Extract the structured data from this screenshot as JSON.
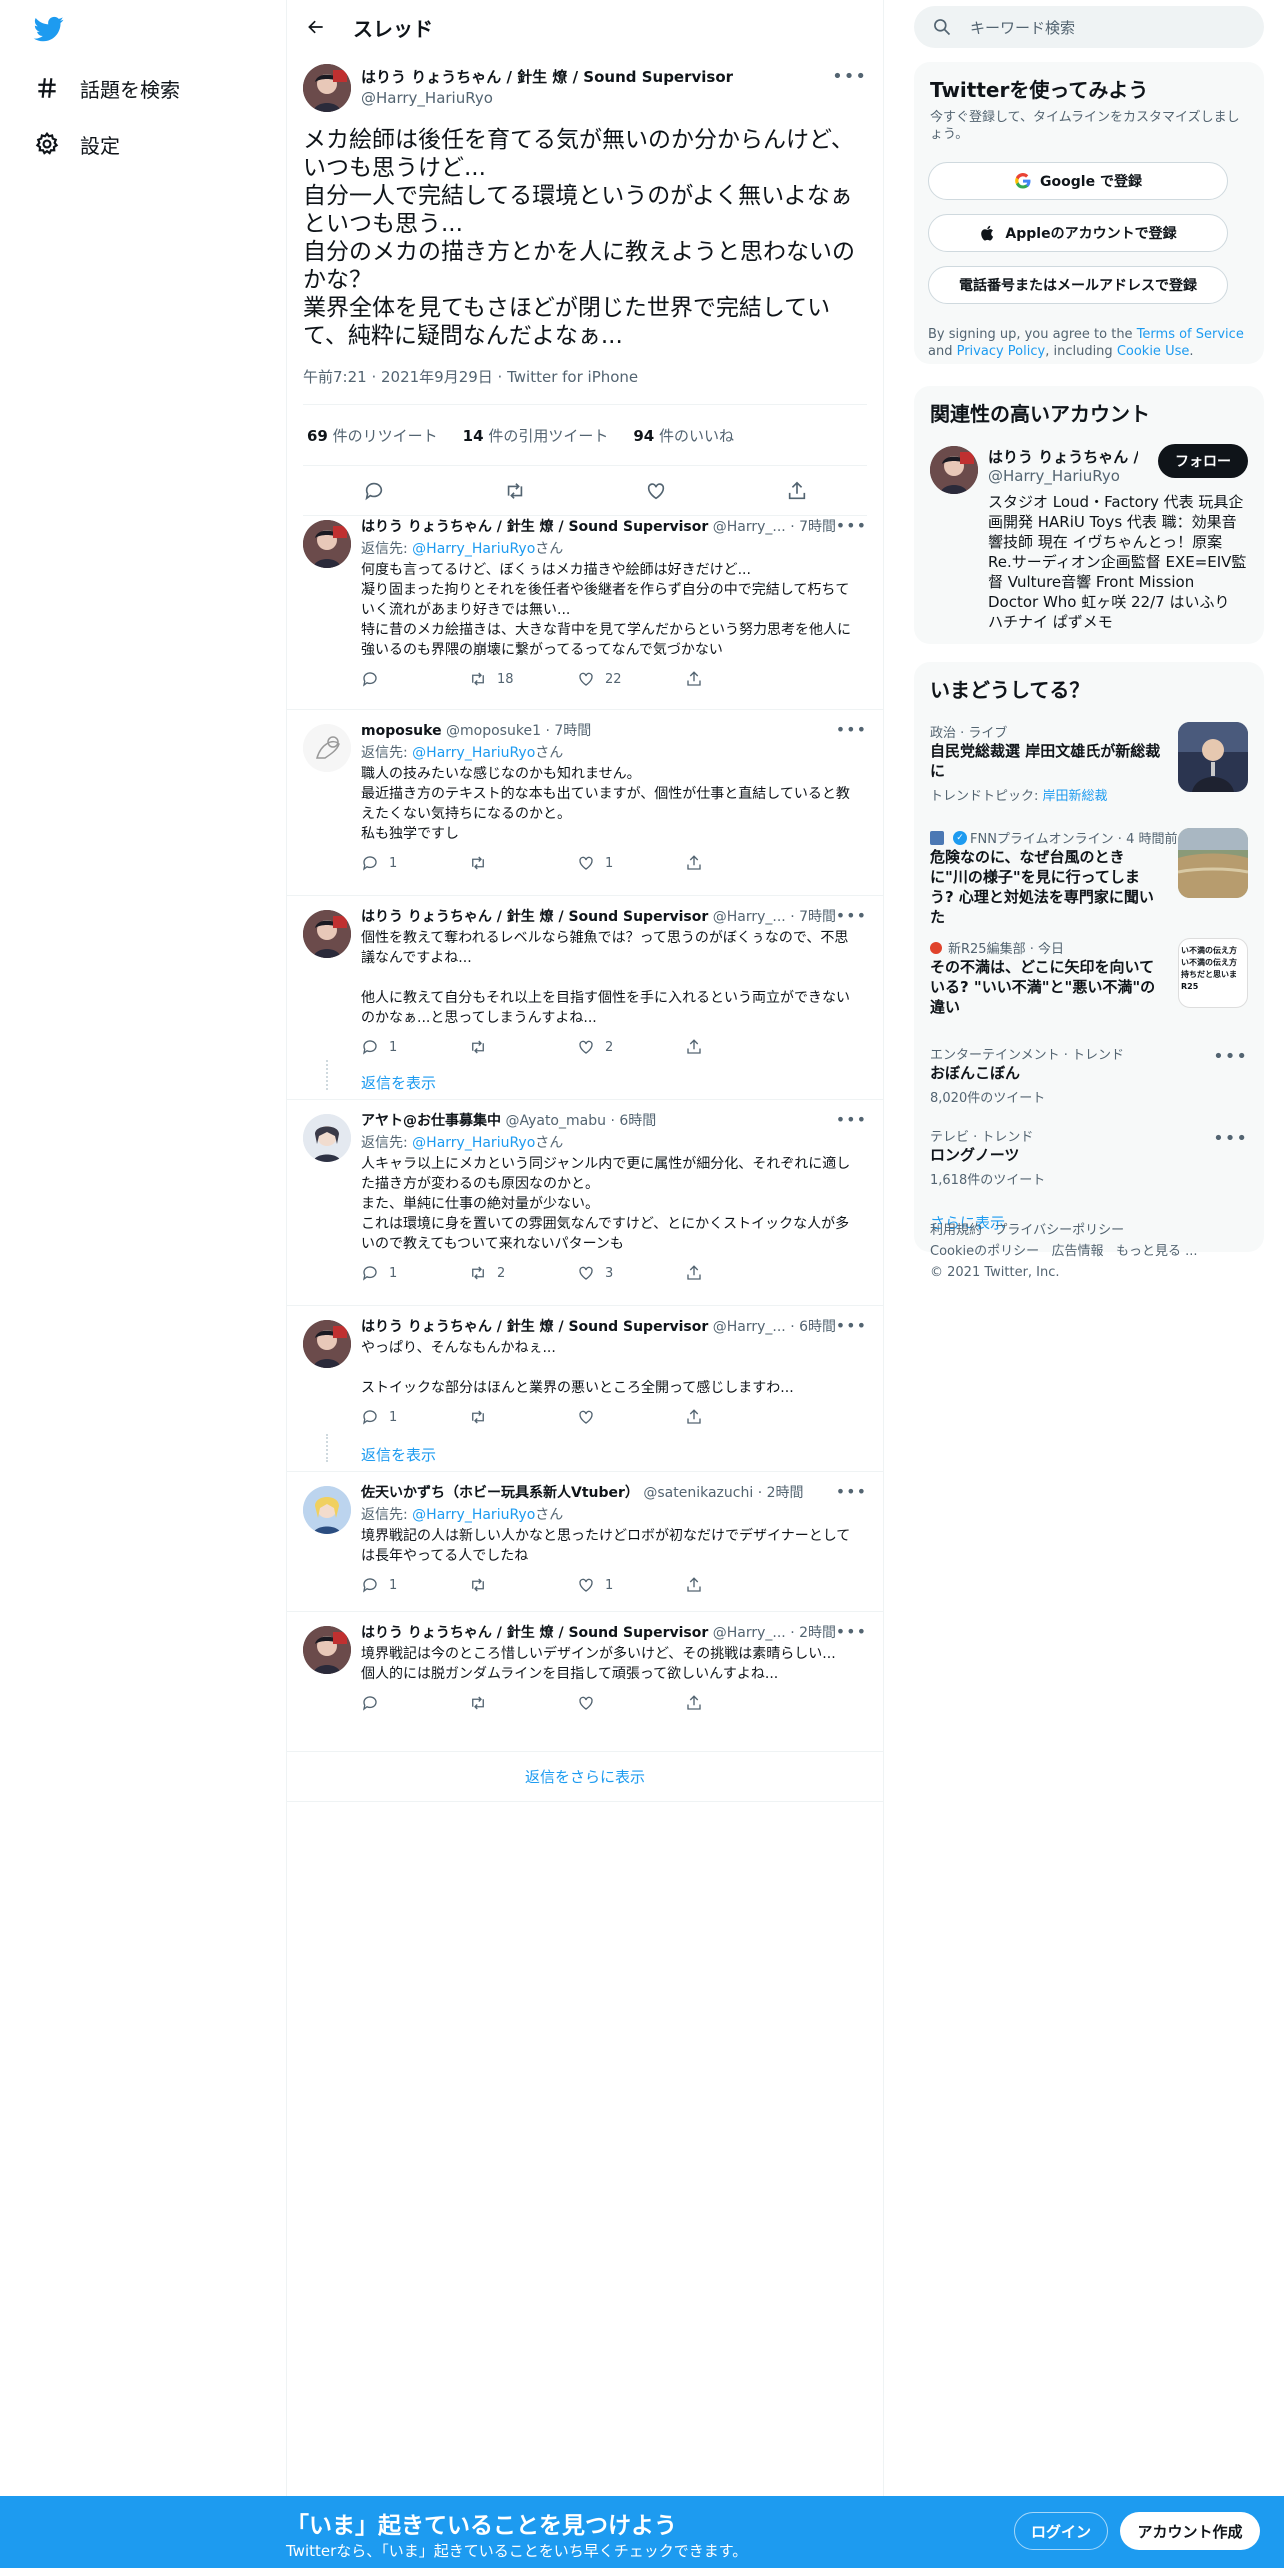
{
  "nav": {
    "explore_label": "話題を検索",
    "settings_label": "設定"
  },
  "header": {
    "title": "スレッド"
  },
  "main_tweet": {
    "name": "はりう りょうちゃん / 針生 燎 / Sound Supervisor",
    "handle": "@Harry_HariuRyo",
    "text": "メカ絵師は後任を育てる気が無いのか分からんけど、いつも思うけど...\n自分一人で完結してる環境というのがよく無いよなぁといつも思う...\n自分のメカの描き方とかを人に教えようと思わないのかな？\n業界全体を見てもさほどが閉じた世界で完結していて、純粋に疑問なんだよなぁ...",
    "meta": "午前7:21 · 2021年9月29日 · Twitter for iPhone",
    "retweets_num": "69",
    "retweets_label": "件のリツイート",
    "quotes_num": "14",
    "quotes_label": "件の引用ツイート",
    "likes_num": "94",
    "likes_label": "件のいいね"
  },
  "replies": [
    {
      "name": "はりう りょうちゃん / 針生 燎 / Sound Supervisor",
      "handle": "@Harry_...",
      "time": "· 7時間",
      "replying_prefix": "返信先: ",
      "replying_to": "@Harry_HariuRyo",
      "replying_suffix": "さん",
      "text": "何度も言ってるけど、ぼくぅはメカ描きや絵師は好きだけど...\n凝り固まった拘りとそれを後任者や後継者を作らず自分の中で完結して朽ちていく流れがあまり好きでは無い...\n特に昔のメカ絵描きは、大きな背中を見て学んだからという努力思考を他人に強いるのも界隈の崩壊に繋がってるってなんで気づかない",
      "reply_count": "",
      "retweet_count": "18",
      "like_count": "22"
    },
    {
      "name": "moposuke",
      "handle": "@moposuke1",
      "time": "· 7時間",
      "replying_prefix": "返信先: ",
      "replying_to": "@Harry_HariuRyo",
      "replying_suffix": "さん",
      "text": "職人の技みたいな感じなのかも知れません。\n最近描き方のテキスト的な本も出ていますが、個性が仕事と直結していると教えたくない気持ちになるのかと。\n私も独学ですし",
      "reply_count": "1",
      "retweet_count": "",
      "like_count": "1"
    },
    {
      "name": "はりう りょうちゃん / 針生 燎 / Sound Supervisor",
      "handle": "@Harry_...",
      "time": "· 7時間",
      "text": "個性を教えて奪われるレベルなら雑魚では？って思うのがぼくぅなので、不思議なんですよね...\n\n他人に教えて自分もそれ以上を目指す個性を手に入れるという両立ができないのかなぁ...と思ってしまうんすよね...",
      "reply_count": "1",
      "retweet_count": "",
      "like_count": "2",
      "show_replies": "返信を表示"
    },
    {
      "name": "アヤト@お仕事募集中",
      "handle": "@Ayato_mabu",
      "time": "· 6時間",
      "replying_prefix": "返信先: ",
      "replying_to": "@Harry_HariuRyo",
      "replying_suffix": "さん",
      "text": "人キャラ以上にメカという同ジャンル内で更に属性が細分化、それぞれに適した描き方が変わるのも原因なのかと。\nまた、単純に仕事の絶対量が少ない。\nこれは環境に身を置いての雰囲気なんですけど、とにかくストイックな人が多いので教えてもついて来れないパターンも",
      "reply_count": "1",
      "retweet_count": "2",
      "like_count": "3"
    },
    {
      "name": "はりう りょうちゃん / 針生 燎 / Sound Supervisor",
      "handle": "@Harry_...",
      "time": "· 6時間",
      "text": "やっぱり、そんなもんかねぇ...\n\nストイックな部分はほんと業界の悪いところ全開って感じしますわ...",
      "reply_count": "1",
      "retweet_count": "",
      "like_count": "",
      "show_replies": "返信を表示"
    },
    {
      "name": "佐天いかずち（ホビー玩具系新人Vtuber）",
      "handle": "@satenikazuchi",
      "time": "· 2時間",
      "replying_prefix": "返信先: ",
      "replying_to": "@Harry_HariuRyo",
      "replying_suffix": "さん",
      "text": "境界戦記の人は新しい人かなと思ったけどロボが初なだけでデザイナーとしては長年やってる人でしたね",
      "reply_count": "1",
      "retweet_count": "",
      "like_count": "1"
    },
    {
      "name": "はりう りょうちゃん / 針生 燎 / Sound Supervisor",
      "handle": "@Harry_...",
      "time": "· 2時間",
      "text": "境界戦記は今のところ惜しいデザインが多いけど、その挑戦は素晴らしい...\n個人的には脱ガンダムラインを目指して頑張って欲しいんすよね...",
      "reply_count": "",
      "retweet_count": "",
      "like_count": ""
    }
  ],
  "more_replies_label": "返信をさらに表示",
  "right": {
    "search_placeholder": "キーワード検索",
    "signup_title": "Twitterを使ってみよう",
    "signup_sub": "今すぐ登録して、タイムラインをカスタマイズしましょう。",
    "google_label": "Google で登録",
    "apple_label": "Appleのアカウントで登録",
    "phone_label": "電話番号またはメールアドレスで登録",
    "terms_prefix": "By signing up, you agree to the ",
    "terms_tos": "Terms of Service",
    "terms_and": " and ",
    "terms_privacy": "Privacy Policy",
    "terms_incl": ", including ",
    "terms_cookie": "Cookie Use",
    "terms_end": ".",
    "related_title": "関連性の高いアカウント",
    "related_name": "はりう りょうちゃん / 針生 燎 / Sound Supervisor",
    "related_handle": "@Harry_HariuRyo",
    "related_bio": "スタジオ Loud・Factory 代表 玩具企画開発 HARiU Toys 代表 職：効果音響技師 現在 イヴちゃんとっ！原案 Re.サーディオン企画監督 EXE=EIV監督 Vulture音響 Front Mission Doctor Who 虹ヶ咲 22/7 はいふり ハチナイ ぱずメモ",
    "follow_label": "フォロー",
    "trends_title": "いまどうしてる？",
    "trends": [
      {
        "cat": "政治 · ライブ",
        "title": "自民党総裁選 岸田文雄氏が新総裁に",
        "sub_prefix": "トレンドトピック: ",
        "sub_link": "岸田新総裁"
      },
      {
        "cat": "FNNプライムオンライン · 4 時間前",
        "title": "危険なのに、なぜ台風のときに\"川の様子\"を見に行ってしまう? 心理と対処法を専門家に聞いた"
      },
      {
        "cat": "新R25編集部 · 今日",
        "title": "その不満は、どこに矢印を向いている? \"いい不満\"と\"悪い不満\"の違い",
        "img_text": "い不満の伝え方\nい不満の伝え方\n持ちだと思いま\nR25"
      },
      {
        "cat": "エンターテインメント · トレンド",
        "title": "おぼんこぼん",
        "count": "8,020件のツイート"
      },
      {
        "cat": "テレビ · トレンド",
        "title": "ロングノーツ",
        "count": "1,618件のツイート"
      }
    ],
    "show_more": "さらに表示",
    "footer": [
      "利用規約",
      "プライバシーポリシー",
      "Cookieのポリシー",
      "広告情報",
      "もっと見る ...",
      "© 2021 Twitter, Inc."
    ]
  },
  "banner": {
    "title": "「いま」起きていることを見つけよう",
    "sub": "Twitterなら、「いま」起きていることをいち早くチェックできます。",
    "login": "ログイン",
    "signup": "アカウント作成"
  },
  "colors": {
    "accent": "#1d9bf0",
    "text": "#0f1419",
    "muted": "#536471",
    "border": "#eff3f4"
  }
}
